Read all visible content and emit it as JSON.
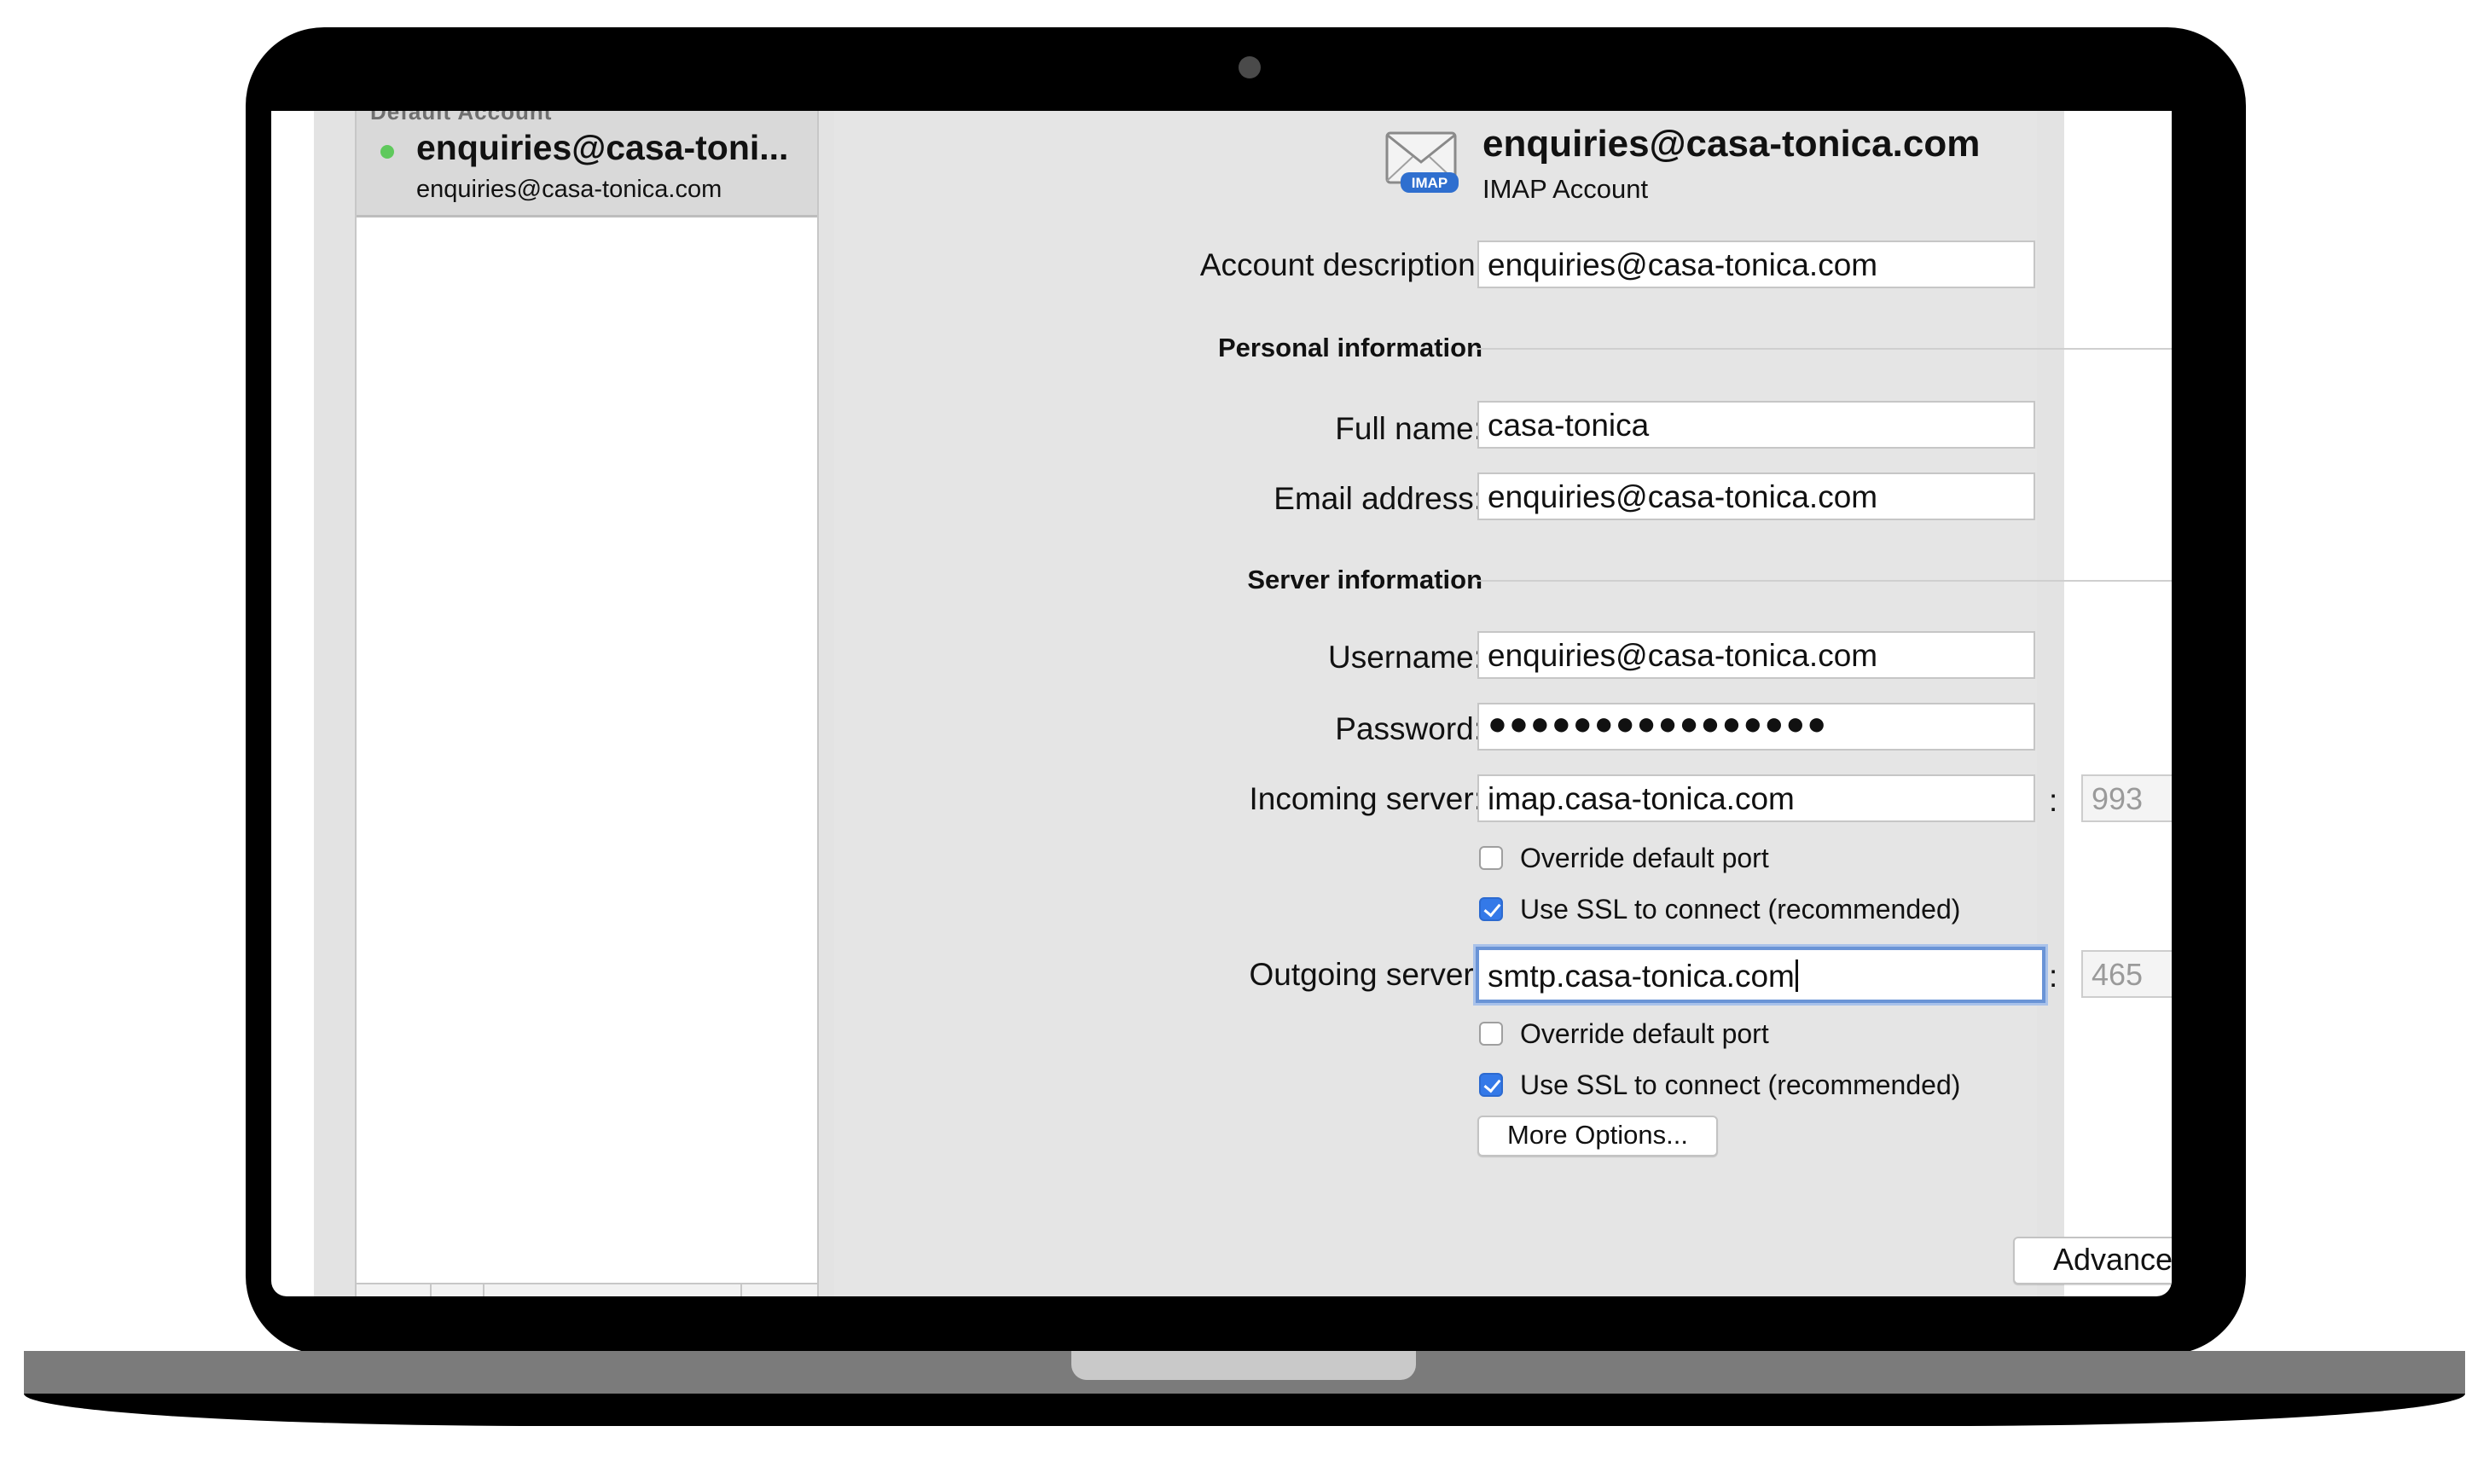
{
  "sidebar": {
    "header": "Default Account",
    "account": {
      "name": "enquiries@casa-toni...",
      "email": "enquiries@casa-tonica.com",
      "status_color": "#5fc95c"
    }
  },
  "header": {
    "icon": "mail-envelope-icon",
    "badge": "IMAP",
    "title": "enquiries@casa-tonica.com",
    "subtitle": "IMAP Account"
  },
  "form": {
    "account_description": {
      "label": "Account description:",
      "value": "enquiries@casa-tonica.com"
    },
    "personal_section": "Personal information",
    "full_name": {
      "label": "Full name:",
      "value": "casa-tonica"
    },
    "email_address": {
      "label": "Email address:",
      "value": "enquiries@casa-tonica.com"
    },
    "server_section": "Server information",
    "username": {
      "label": "Username:",
      "value": "enquiries@casa-tonica.com"
    },
    "password": {
      "label": "Password:",
      "value": "●●●●●●●●●●●●●●●●"
    },
    "incoming": {
      "label": "Incoming server:",
      "value": "imap.casa-tonica.com",
      "colon": ":",
      "port": "993",
      "override_label": "Override default port",
      "override_checked": false,
      "ssl_label": "Use SSL to connect (recommended)",
      "ssl_checked": true
    },
    "outgoing": {
      "label": "Outgoing server:",
      "value": "smtp.casa-tonica.com",
      "colon": ":",
      "port": "465",
      "override_label": "Override default port",
      "override_checked": false,
      "ssl_label": "Use SSL to connect (recommended)",
      "ssl_checked": true
    },
    "more_options": "More Options...",
    "advanced": "Advanced..."
  },
  "colors": {
    "focus_ring": "#6a94d6",
    "checkbox_on": "#3479e8"
  }
}
